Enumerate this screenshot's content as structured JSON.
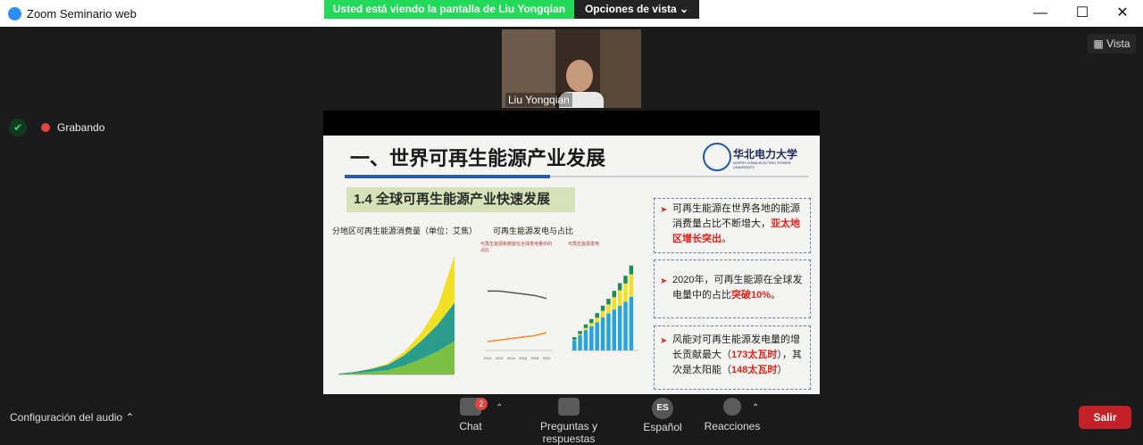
{
  "window": {
    "title": "Zoom Seminario web",
    "minimize": "—",
    "maximize": "☐",
    "close": "✕"
  },
  "banner": {
    "sharing_text": "Usted está viendo la pantalla de Liu Yongqian",
    "view_options": "Opciones de vista ⌄"
  },
  "view_button": {
    "label": "Vista"
  },
  "speaker": {
    "name": "Liu Yongqian"
  },
  "recording": {
    "label": "Grabando"
  },
  "slide": {
    "title": "一、世界可再生能源产业发展",
    "logo_text": "华北电力大学",
    "logo_sub": "NORTH CHINA ELECTRIC POWER UNIVERSITY",
    "section": "1.4 全球可再生能源产业快速发展",
    "chart1_caption": "分地区可再生能源消费量（单位：艾焦）",
    "chart2_caption": "可再生能源发电与占比",
    "chart2a_small": "可再生能源和核能在全球发电量中的占比",
    "chart2b_small": "可再生能源发电",
    "bullets": [
      {
        "pre": "可再生能源在世界各地的能源消费量占比不断增大，",
        "hi": "亚太地区增长突出",
        "post": "。"
      },
      {
        "pre": "2020年，可再生能源在全球发电量中的占比",
        "hi": "突破10%",
        "post": "。"
      },
      {
        "pre": "风能对可再生能源发电量的增长贡献最大（",
        "hi": "173太瓦时",
        "post": "），其次是太阳能（",
        "hi2": "148太瓦时",
        "post2": "）"
      }
    ]
  },
  "chart_data": [
    {
      "type": "area",
      "title": "分地区可再生能源消费量（单位：艾焦）",
      "x": [
        1965,
        1975,
        1985,
        1995,
        2005,
        2010,
        2015,
        2020
      ],
      "series": [
        {
          "values": [
            0.1,
            0.3,
            0.6,
            1.0,
            2.0,
            3.5,
            5.2,
            7.5
          ]
        },
        {
          "values": [
            0.1,
            0.3,
            0.7,
            1.2,
            2.4,
            4.0,
            6.0,
            8.5
          ]
        },
        {
          "values": [
            0,
            0,
            0.1,
            0.3,
            0.8,
            1.8,
            4.0,
            10.5
          ]
        }
      ],
      "colors": [
        "#7bc043",
        "#2a9d8f",
        "#f2e024",
        "#d94b3a"
      ]
    },
    {
      "type": "line",
      "title": "可再生能源和核能在全球发电量中的占比",
      "x": [
        2010,
        2012,
        2014,
        2016,
        2018,
        2020
      ],
      "series": [
        {
          "values": [
            40,
            40,
            39,
            38,
            37,
            35
          ],
          "color": "#555555"
        },
        {
          "values": [
            6,
            7,
            8,
            9,
            10,
            12
          ],
          "color": "#f28c28"
        }
      ],
      "ylim": [
        0,
        60
      ]
    },
    {
      "type": "bar",
      "title": "可再生能源发电",
      "categories": [
        "2010",
        "2011",
        "2012",
        "2013",
        "2014",
        "2015",
        "2016",
        "2017",
        "2018",
        "2019",
        "2020"
      ],
      "series": [
        {
          "values": [
            40,
            60,
            80,
            95,
            110,
            130,
            145,
            160,
            175,
            190,
            210
          ],
          "color": "#29a3dc"
        },
        {
          "values": [
            2,
            4,
            8,
            12,
            18,
            25,
            35,
            48,
            60,
            72,
            88
          ],
          "color": "#f2e024"
        },
        {
          "values": [
            10,
            12,
            14,
            16,
            18,
            20,
            22,
            25,
            28,
            30,
            34
          ],
          "color": "#1f8a5a"
        }
      ]
    }
  ],
  "bottom": {
    "audio_label": "Configuración del audio",
    "chat_label": "Chat",
    "chat_badge": "2",
    "qa_label": "Preguntas y respuestas",
    "lang_label": "Español",
    "lang_icon": "ES",
    "reactions_label": "Reacciones",
    "exit_label": "Salir"
  },
  "colors": {
    "share_green": "#23d959",
    "exit_red": "#c42025",
    "accent_blue": "#2a5caa"
  }
}
